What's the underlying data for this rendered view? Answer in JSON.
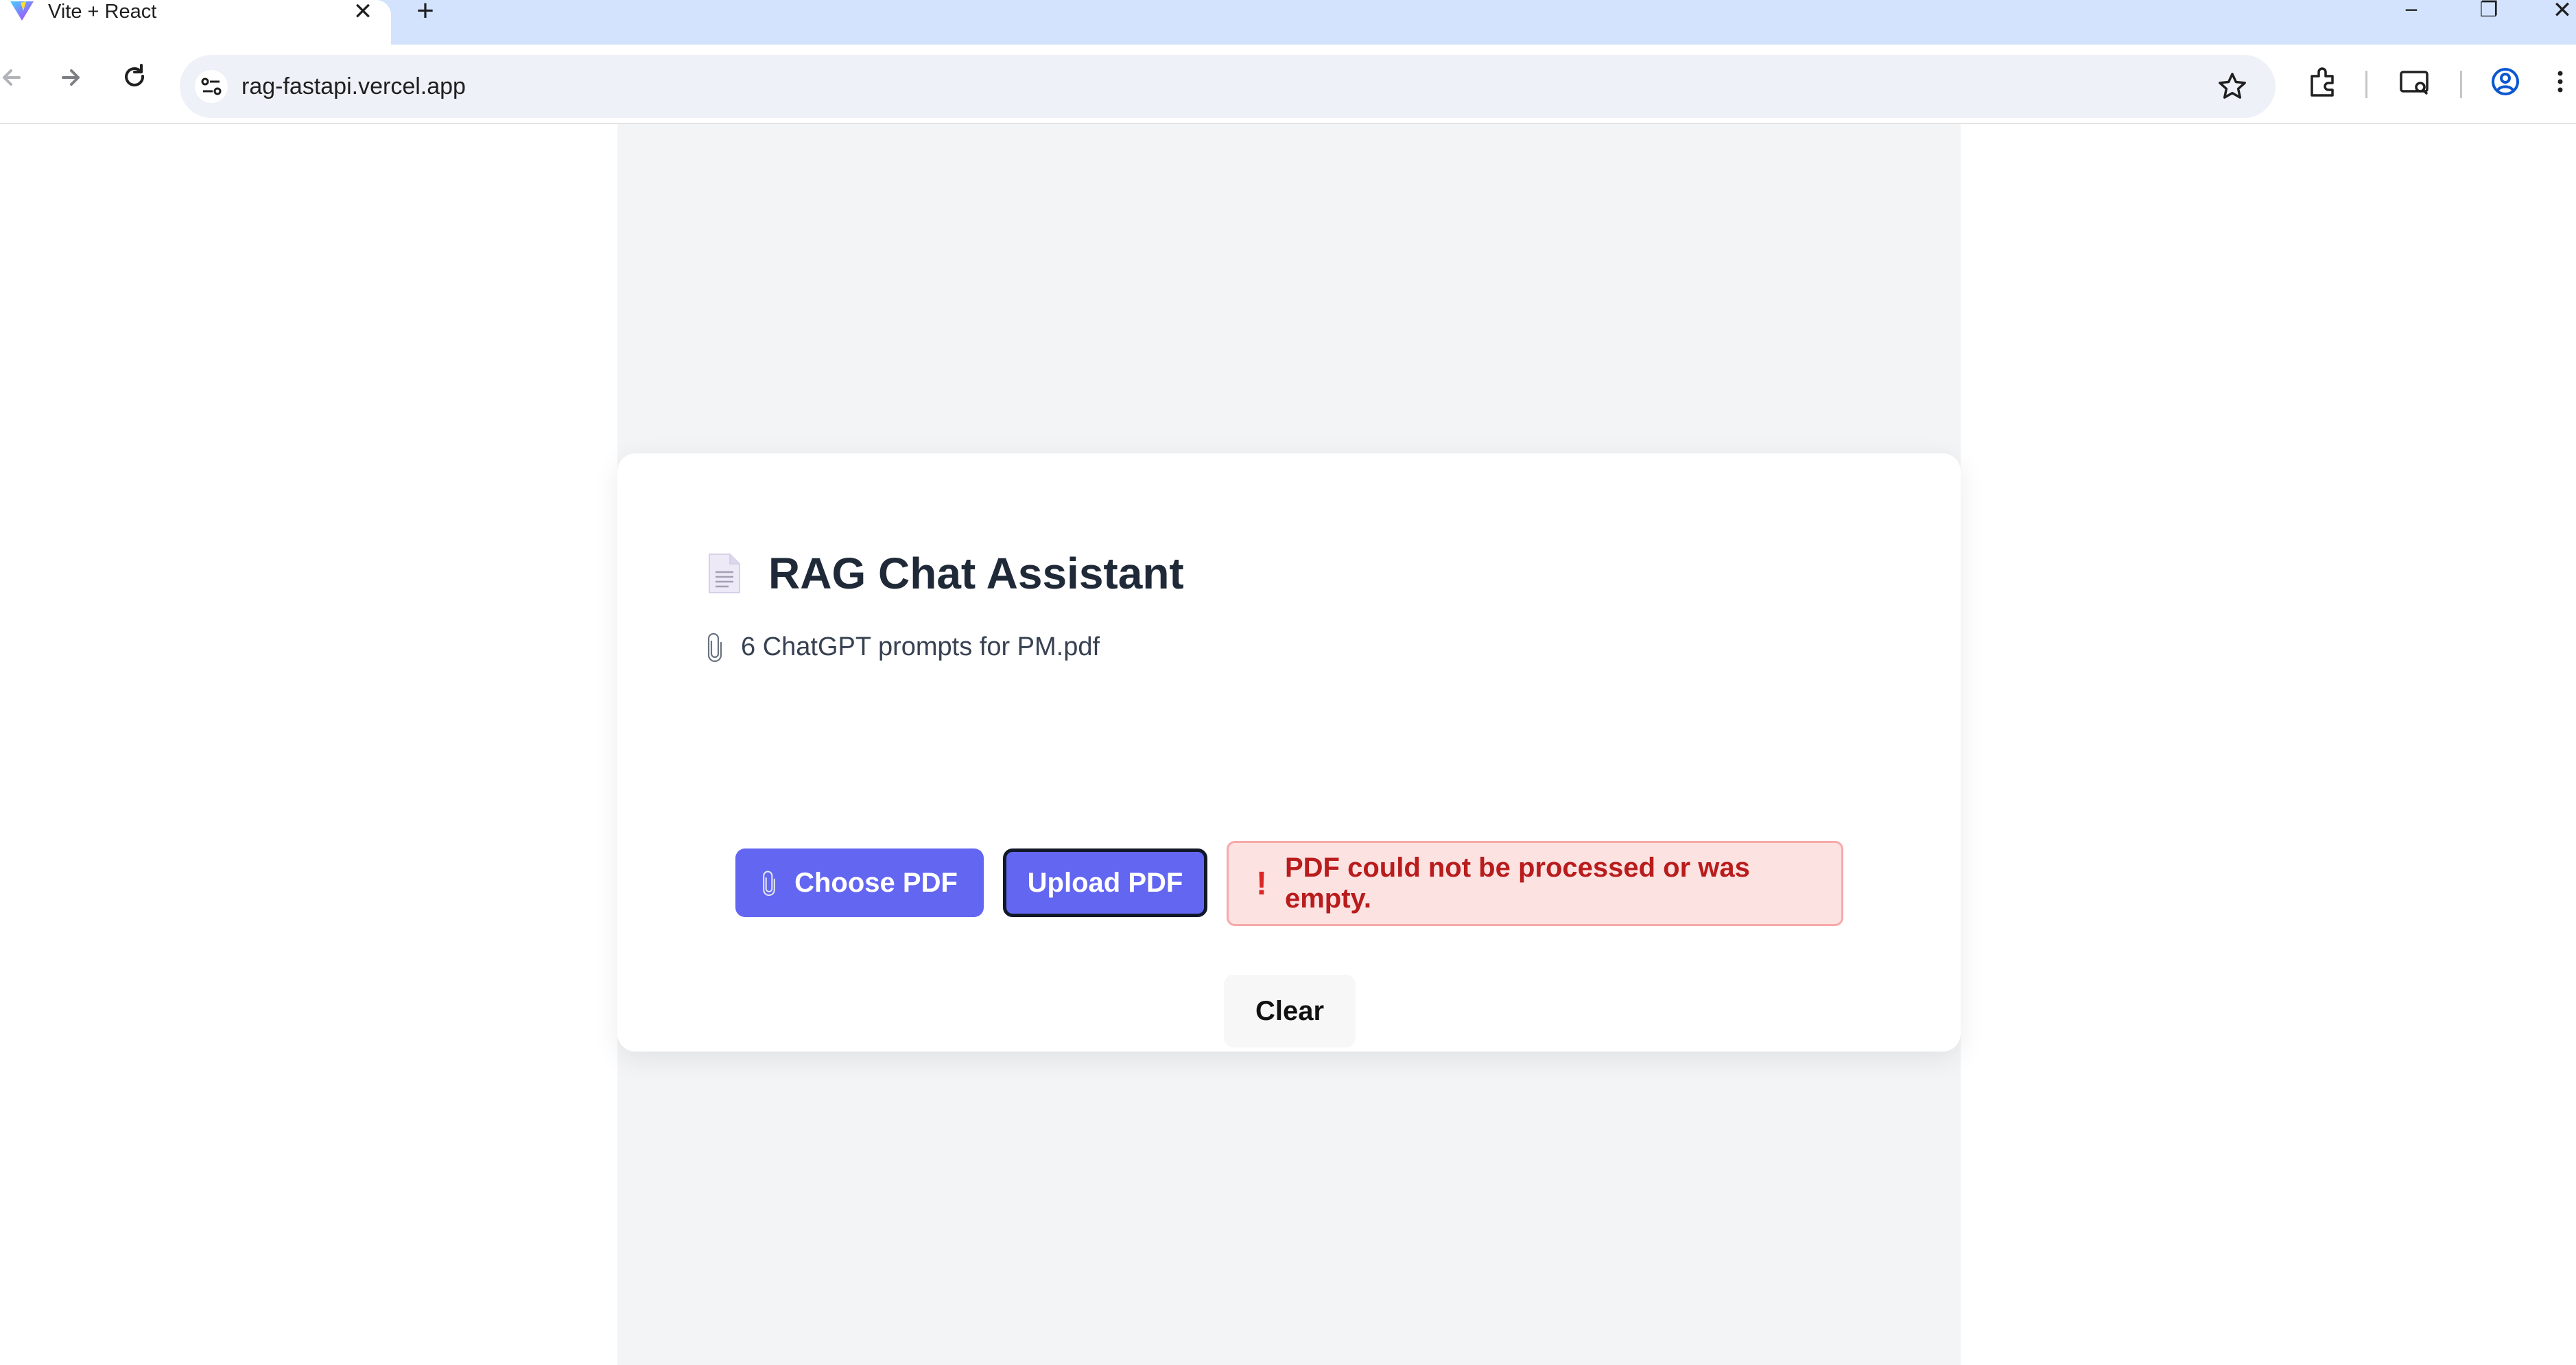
{
  "browser": {
    "tab_title": "Vite + React",
    "tab_close": "✕",
    "new_tab": "+",
    "url": "rag-fastapi.vercel.app",
    "window_minimize": "−",
    "window_restore": "❐",
    "window_close": "✕"
  },
  "app": {
    "title": "RAG Chat Assistant",
    "selected_file": "6 ChatGPT prompts for PM.pdf",
    "choose_pdf_label": "Choose PDF",
    "upload_pdf_label": "Upload PDF",
    "error_icon": "!",
    "error_message": "PDF could not be processed or was empty.",
    "clear_label": "Clear"
  },
  "colors": {
    "accent": "#6366f1",
    "error_bg": "#fde2e2",
    "error_text": "#b91c1c",
    "page_bg": "#f3f4f6"
  },
  "icons": [
    "vite-logo-icon",
    "close-icon",
    "plus-icon",
    "back-icon",
    "forward-icon",
    "reload-icon",
    "site-settings-icon",
    "star-icon",
    "extensions-icon",
    "tab-search-icon",
    "profile-icon",
    "more-icon",
    "document-icon",
    "paperclip-icon",
    "exclamation-icon"
  ]
}
